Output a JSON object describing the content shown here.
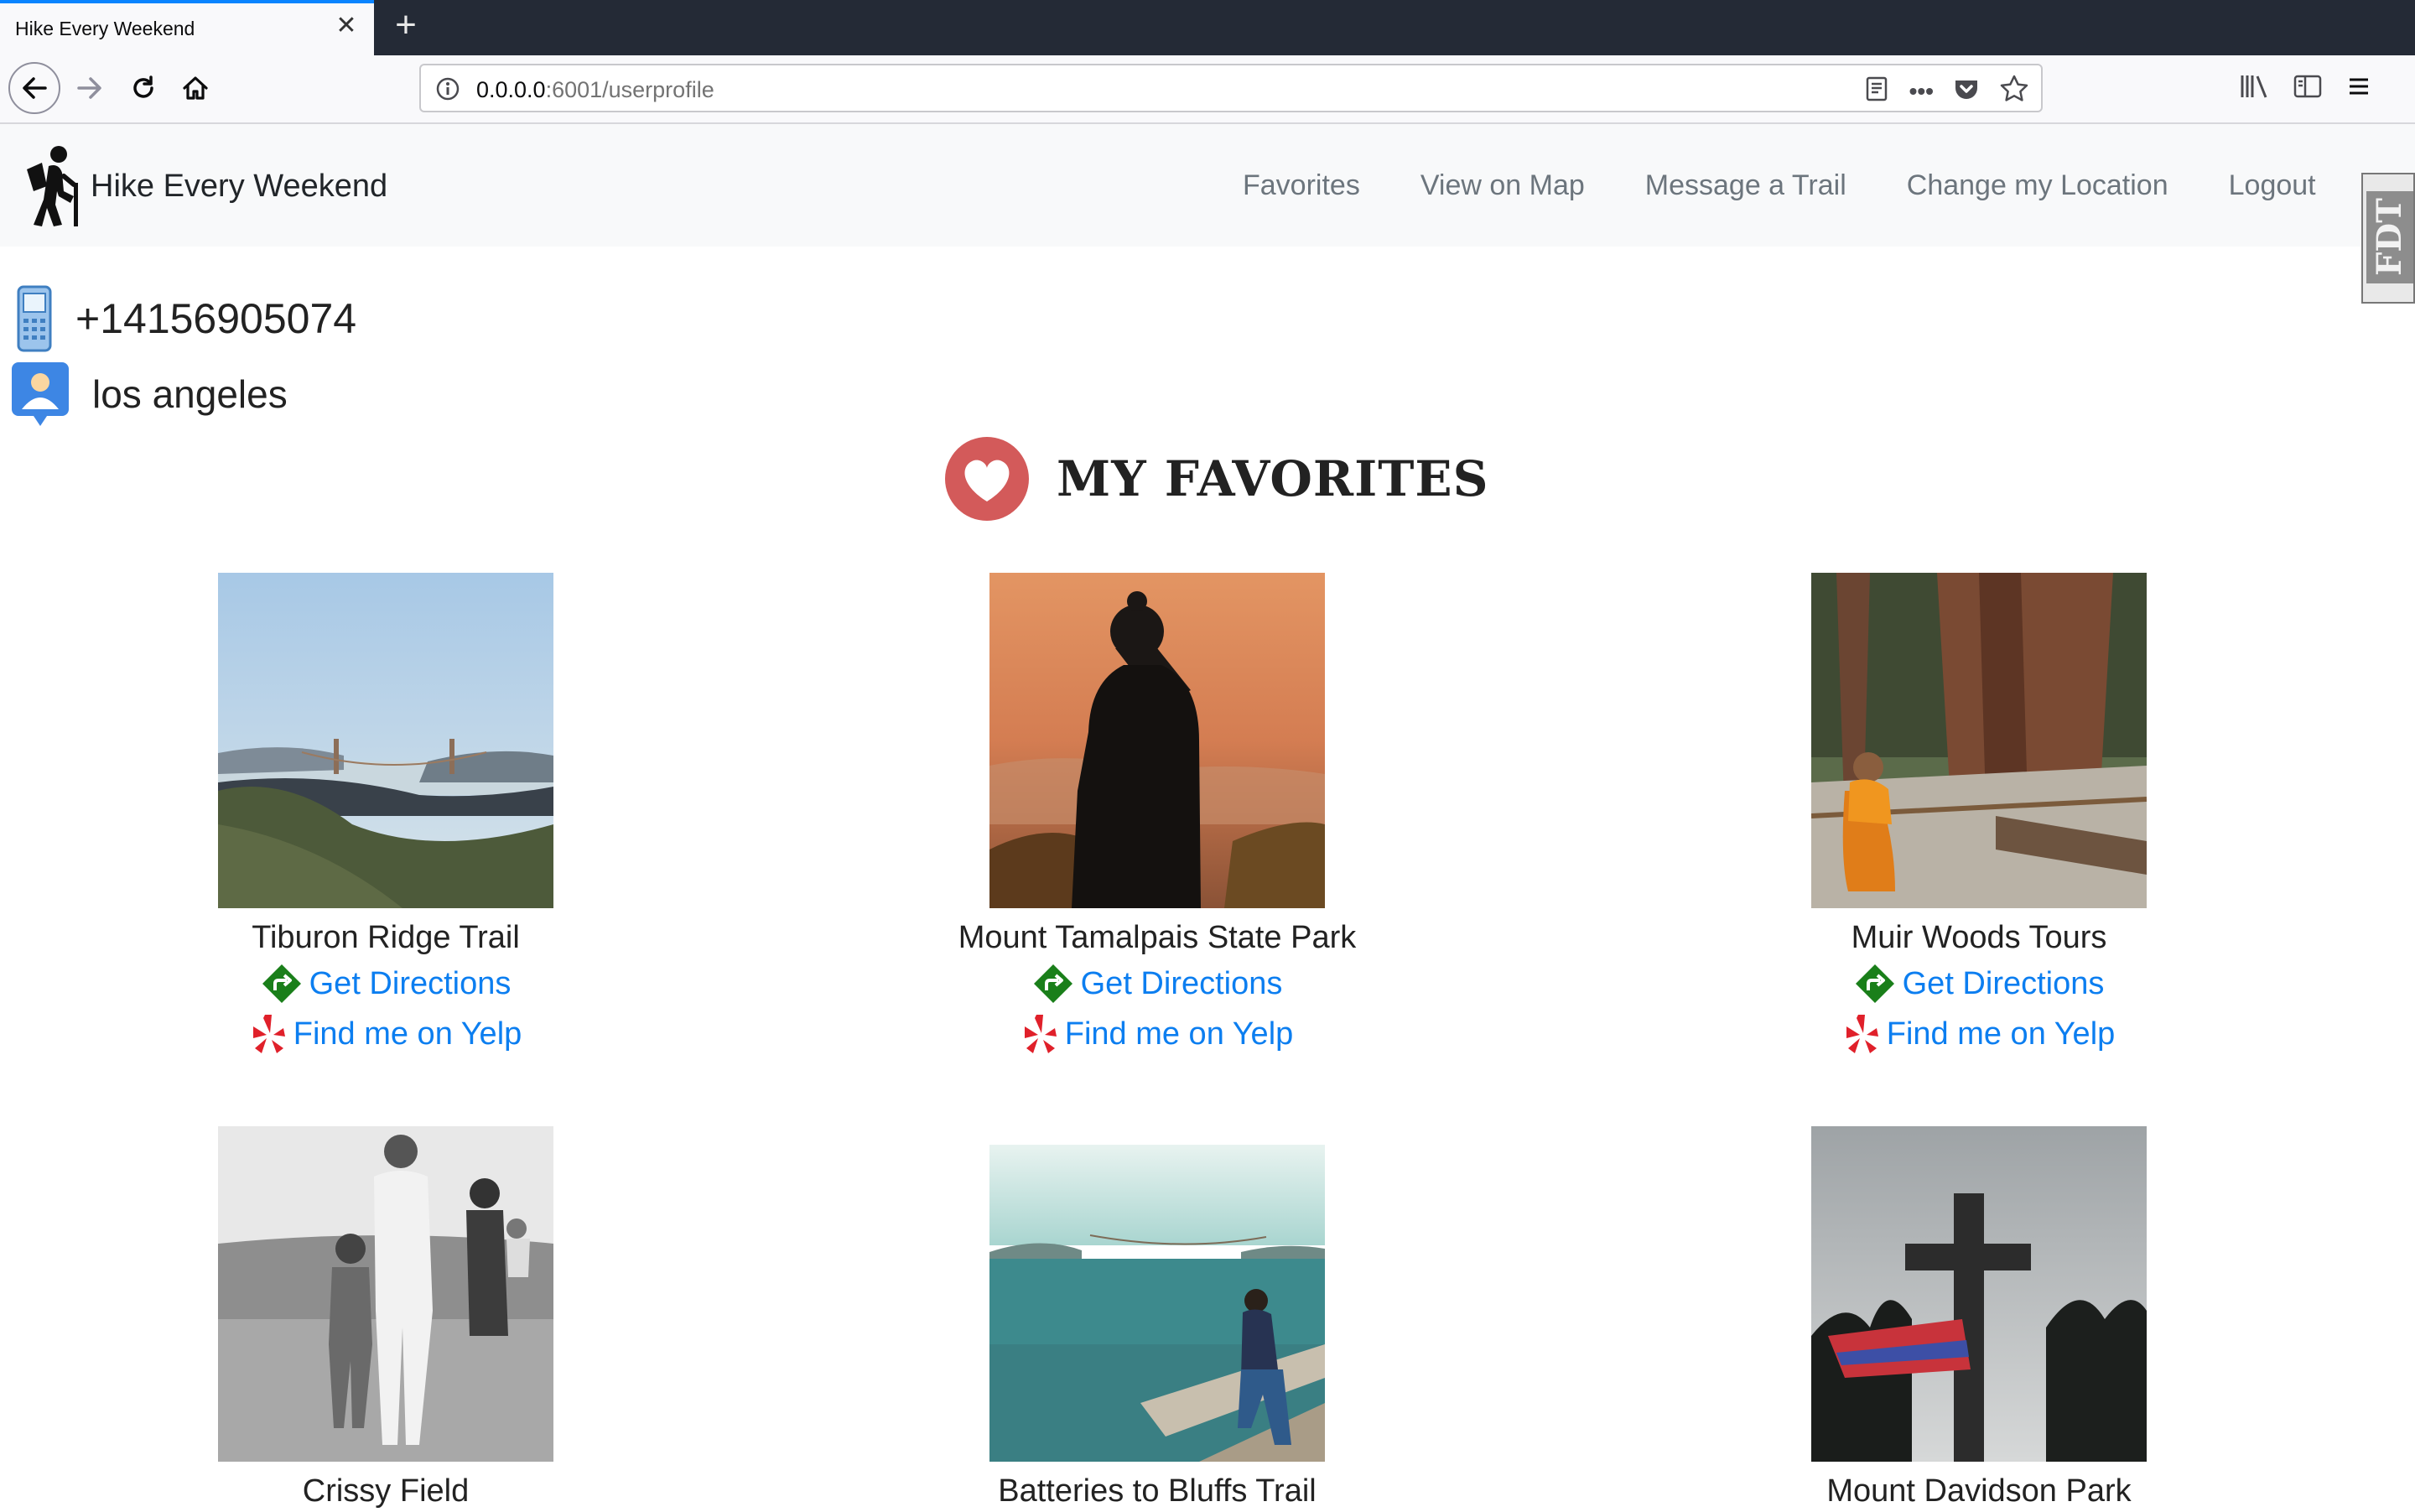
{
  "browser": {
    "tab_title": "Hike Every Weekend",
    "tab_close": "✕",
    "new_tab": "+",
    "url_host": "0.0.0.0",
    "url_rest": ":6001/userprofile",
    "url_more": "•••"
  },
  "site": {
    "brand": "Hike Every Weekend",
    "nav": {
      "favorites": "Favorites",
      "view_on_map": "View on Map",
      "message_a_trail": "Message a Trail",
      "change_location": "Change my Location",
      "logout": "Logout"
    },
    "fdt_label": "FDT"
  },
  "profile": {
    "phone": "+14156905074",
    "location": "los angeles"
  },
  "favorites": {
    "title": "MY FAVORITES",
    "directions_label": "Get Directions",
    "yelp_label": "Find me on Yelp",
    "items": [
      {
        "name": "Tiburon Ridge Trail"
      },
      {
        "name": "Mount Tamalpais State Park"
      },
      {
        "name": "Muir Woods Tours"
      },
      {
        "name": "Crissy Field"
      },
      {
        "name": "Batteries to Bluffs Trail"
      },
      {
        "name": "Mount Davidson Park"
      }
    ]
  },
  "colors": {
    "link": "#0c7ef0",
    "heart": "#d35a5a",
    "directions_icon": "#1a7f1a",
    "yelp_icon": "#e0202a",
    "tab_accent": "#0a84ff"
  }
}
